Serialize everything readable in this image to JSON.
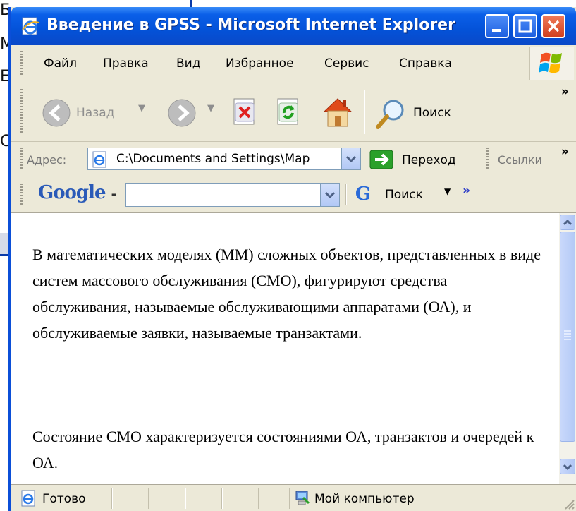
{
  "background_window": {
    "fragments": [
      "Б",
      "М",
      "Е",
      "С"
    ]
  },
  "window": {
    "title": "Введение в GPSS - Microsoft Internet Explorer"
  },
  "menu": {
    "items": [
      "Файл",
      "Правка",
      "Вид",
      "Избранное",
      "Сервис",
      "Справка"
    ]
  },
  "toolbar": {
    "back_label": "Назад",
    "search_label": "Поиск",
    "more": "»"
  },
  "address": {
    "label": "Адрес:",
    "value": "C:\\Documents and Settings\\Мар",
    "go_label": "Переход",
    "links_label": "Ссылки",
    "more": "»"
  },
  "google": {
    "logo": "Google",
    "logo_suffix": "-",
    "search_placeholder": "",
    "search_label": "Поиск",
    "more": "»"
  },
  "content": {
    "paragraphs": [
      "В математических моделях (ММ) сложных объектов, представленных в виде систем массового обслуживания (СМО), фигурируют средства обслуживания, называемые обслуживающими аппаратами (ОА), и обслуживаемые заявки, называемые транзактами.",
      "Состояние СМО характеризуется состояниями ОА, транзактов и очередей к ОА."
    ]
  },
  "status": {
    "text": "Готово",
    "zone": "Мой компьютер"
  },
  "colors": {
    "titlebar": "#0452d8",
    "chrome": "#ece9d8",
    "close_button": "#d2401e"
  }
}
